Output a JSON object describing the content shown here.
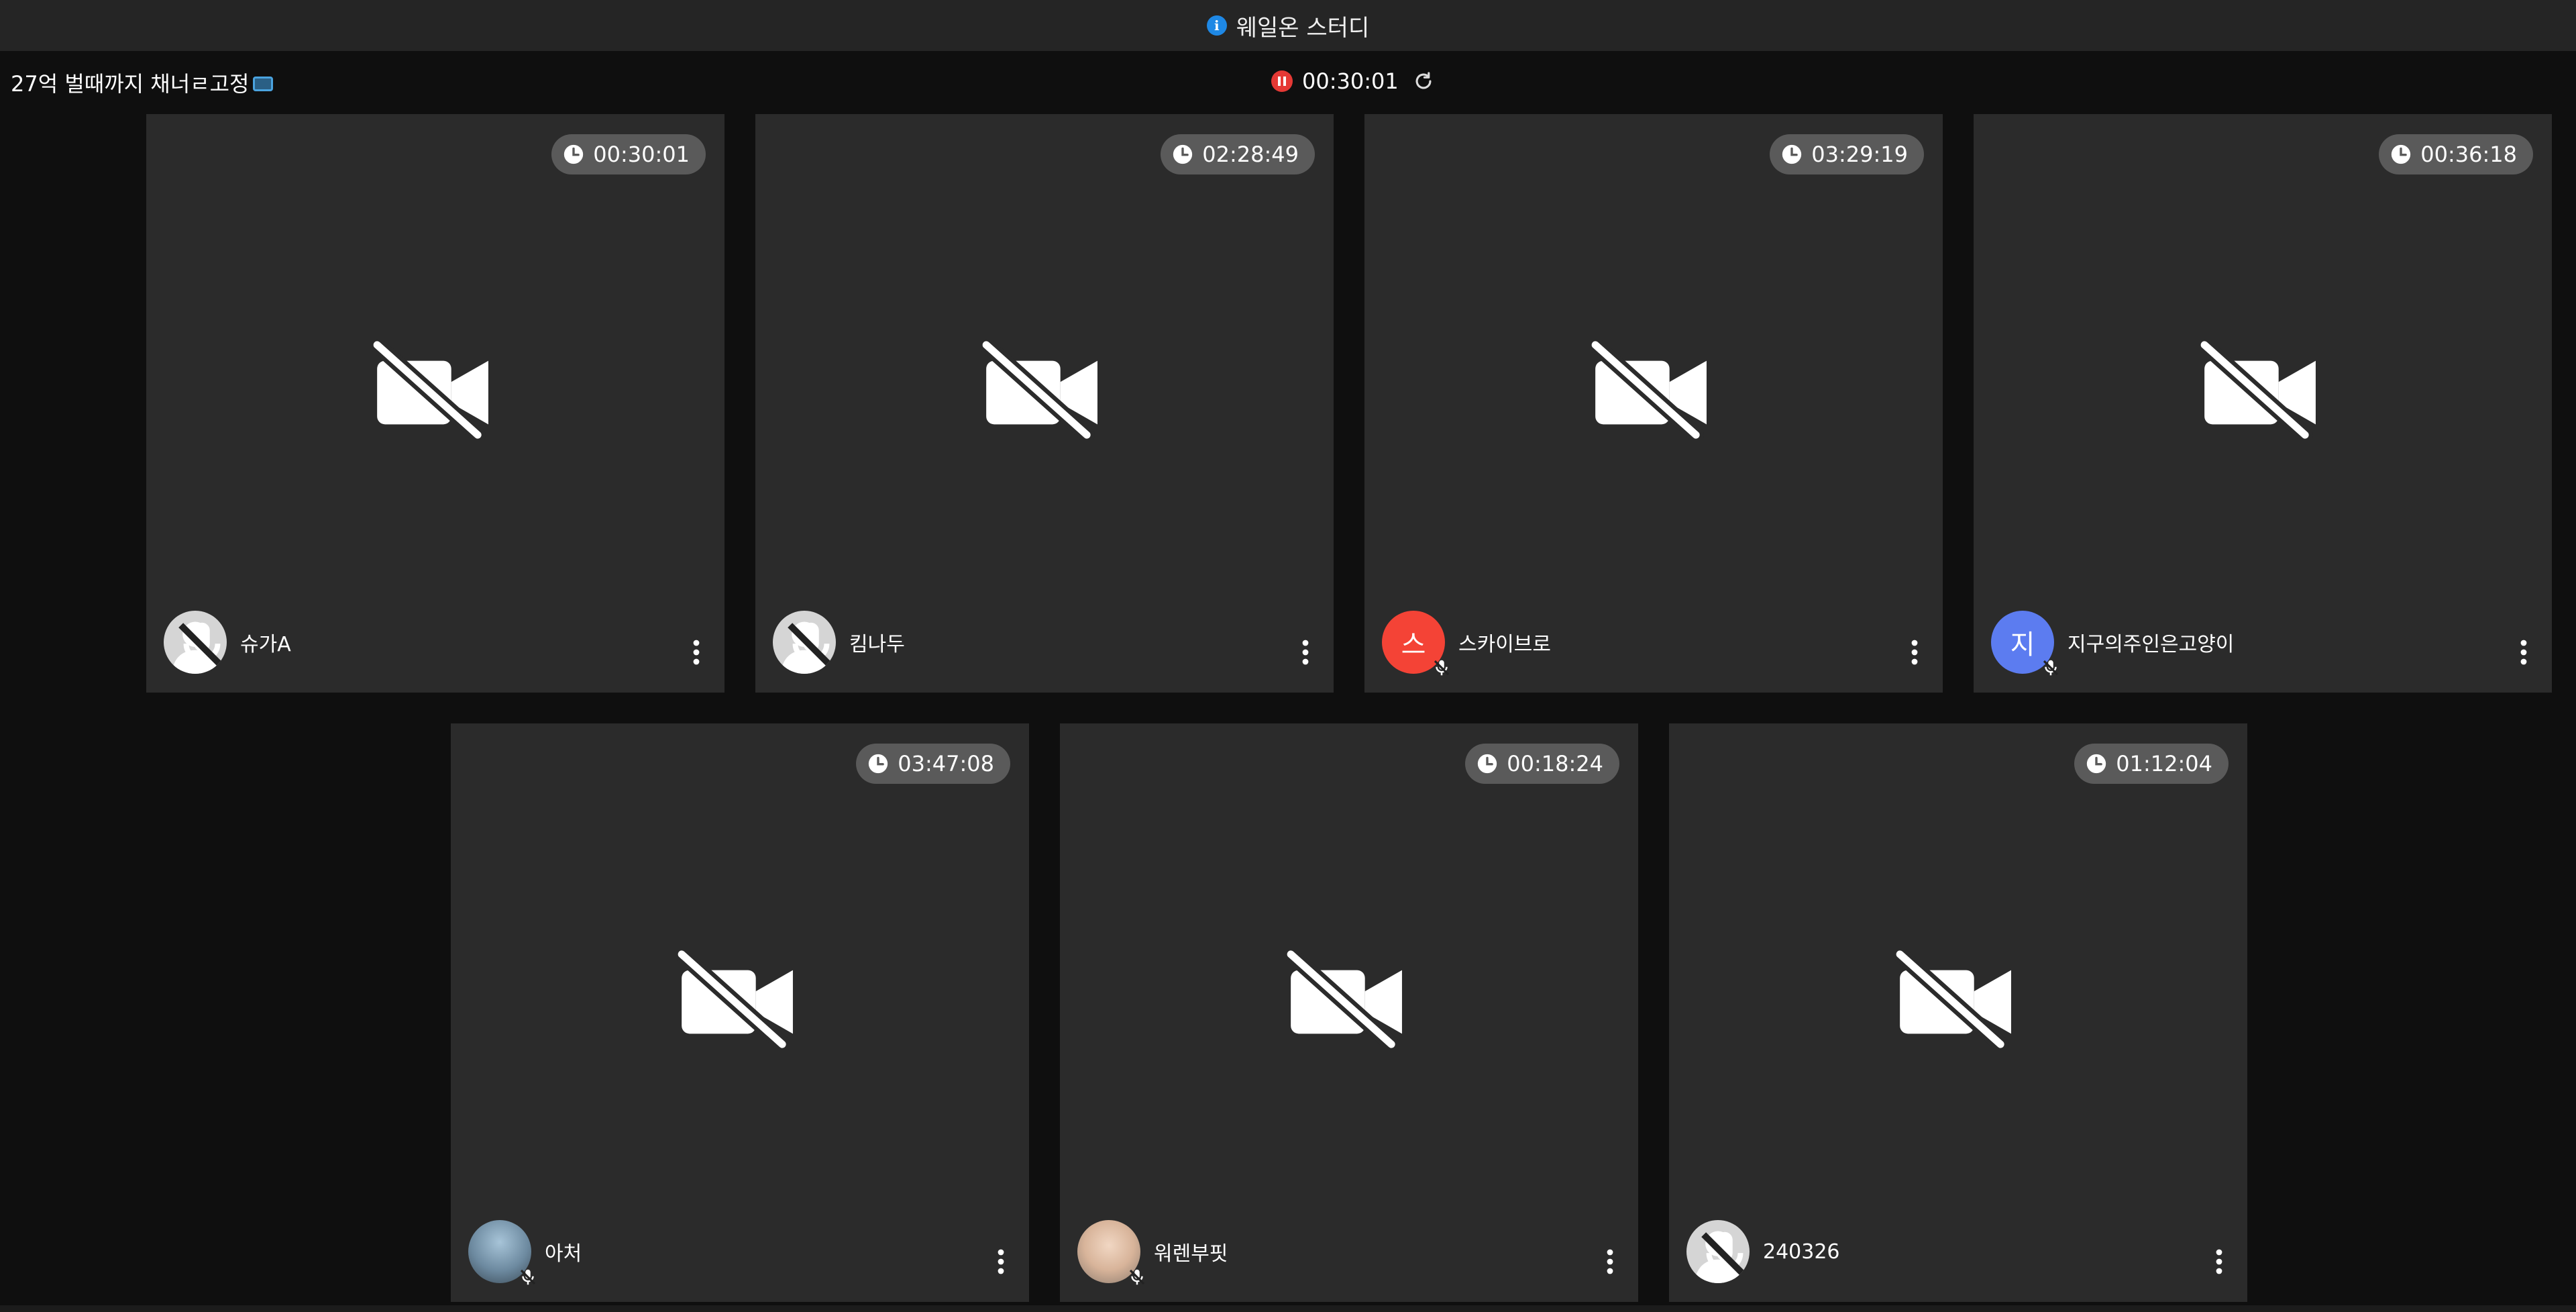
{
  "window": {
    "title": "웨일온 스터디"
  },
  "channel": {
    "title": "27억 벌때까지 채너ㄹ고정"
  },
  "session": {
    "elapsed": "00:30:01"
  },
  "participants": [
    {
      "name": "슈가A",
      "timer": "00:30:01",
      "avatar": "default"
    },
    {
      "name": "킴나두",
      "timer": "02:28:49",
      "avatar": "default"
    },
    {
      "name": "스카이브로",
      "timer": "03:29:19",
      "avatar": "initial",
      "initial": "스",
      "color": "#f44336"
    },
    {
      "name": "지구의주인은고양이",
      "timer": "00:36:18",
      "avatar": "initial",
      "initial": "지",
      "color": "#5c7cf0"
    },
    {
      "name": "아처",
      "timer": "03:47:08",
      "avatar": "photo"
    },
    {
      "name": "워렌부핏",
      "timer": "00:18:24",
      "avatar": "photo"
    },
    {
      "name": "240326",
      "timer": "01:12:04",
      "avatar": "default"
    }
  ],
  "colors": {
    "background": "#0f0f0f",
    "tile": "#2b2b2b",
    "timer_pill": "#5a5a5a",
    "record": "#e53935",
    "info": "#1e88e5"
  }
}
